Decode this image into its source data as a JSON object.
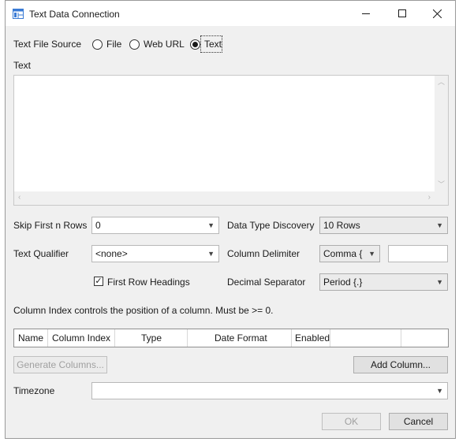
{
  "window": {
    "title": "Text Data Connection",
    "controls": {
      "minimize": "—",
      "maximize": "☐",
      "close": "✕"
    }
  },
  "source": {
    "label": "Text File Source",
    "options": [
      "File",
      "Web URL",
      "Text"
    ],
    "selected": "Text"
  },
  "text_section": {
    "label": "Text",
    "value": ""
  },
  "settings": {
    "skip_rows_label": "Skip First n Rows",
    "skip_rows_value": "0",
    "qualifier_label": "Text Qualifier",
    "qualifier_value": "<none>",
    "first_row_headings_label": "First Row Headings",
    "first_row_headings_checked": true,
    "type_discovery_label": "Data Type Discovery",
    "type_discovery_value": "10 Rows",
    "column_delimiter_label": "Column Delimiter",
    "column_delimiter_value": "Comma {",
    "column_delimiter_custom": "",
    "decimal_separator_label": "Decimal Separator",
    "decimal_separator_value": "Period {.}"
  },
  "columns": {
    "info": "Column Index controls the position of a column. Must be >= 0.",
    "headers": [
      "Name",
      "Column Index",
      "Type",
      "Date Format",
      "Enabled"
    ],
    "generate_button": "Generate Columns...",
    "add_button": "Add Column..."
  },
  "timezone": {
    "label": "Timezone",
    "value": ""
  },
  "footer": {
    "ok": "OK",
    "cancel": "Cancel"
  },
  "icons": {
    "app": "table-icon",
    "dropdown": "chevron-down-icon"
  },
  "colors": {
    "background": "#f0f0f0",
    "app_icon": "#3a7bd5"
  }
}
